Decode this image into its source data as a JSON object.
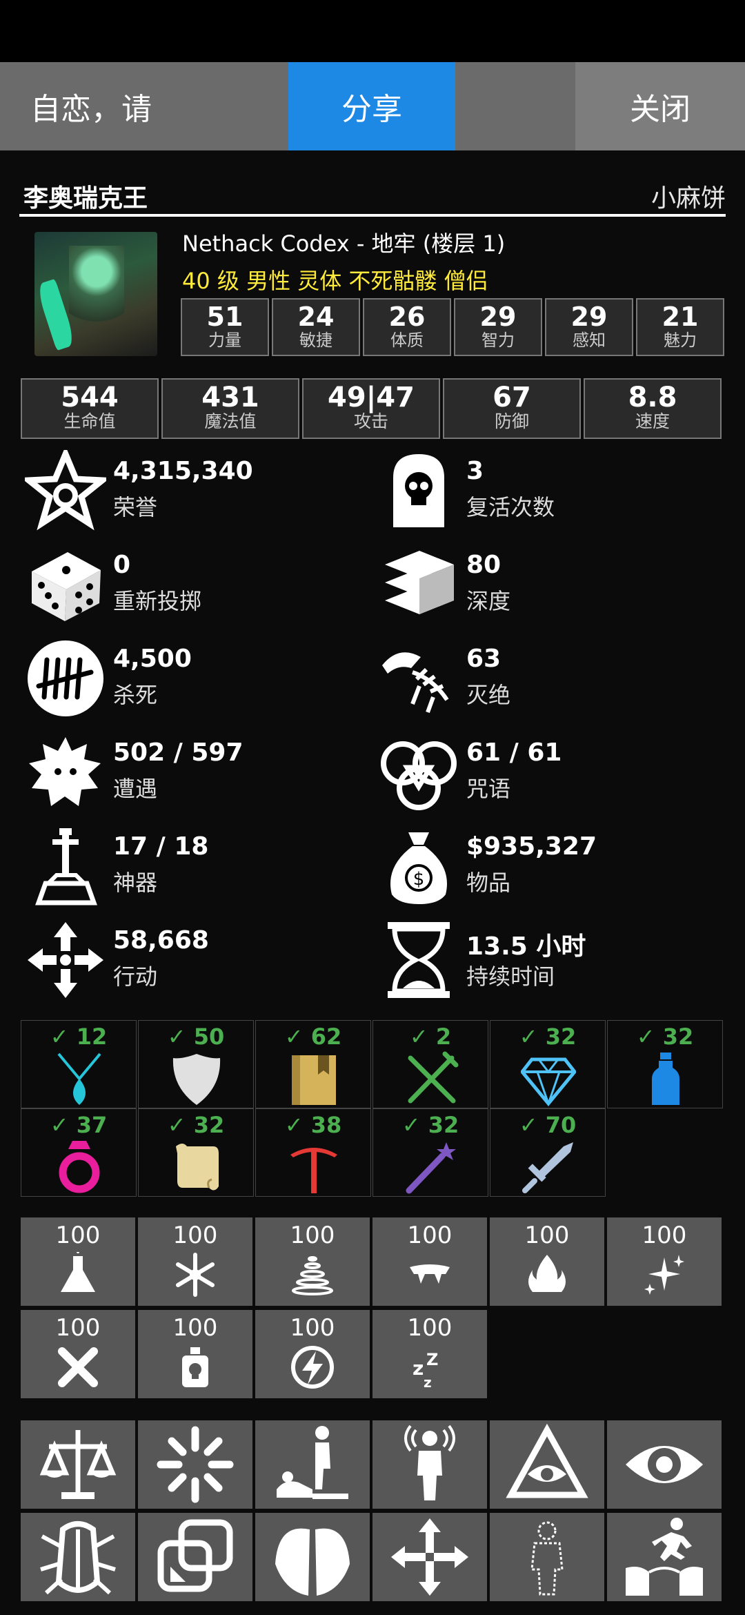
{
  "tabs": {
    "left": "自恋，请",
    "mid": "分享",
    "right": "关闭"
  },
  "header": {
    "name": "李奥瑞克王",
    "player": "小麻饼"
  },
  "game": {
    "title": "Nethack Codex - 地牢 (楼层 1)",
    "subtitle": "40 级 男性 灵体 不死骷髅 僧侣"
  },
  "attributes": [
    {
      "v": "51",
      "l": "力量"
    },
    {
      "v": "24",
      "l": "敏捷"
    },
    {
      "v": "26",
      "l": "体质"
    },
    {
      "v": "29",
      "l": "智力"
    },
    {
      "v": "29",
      "l": "感知"
    },
    {
      "v": "21",
      "l": "魅力"
    }
  ],
  "vitals": [
    {
      "v": "544",
      "l": "生命值"
    },
    {
      "v": "431",
      "l": "魔法值"
    },
    {
      "v": "49|47",
      "l": "攻击"
    },
    {
      "v": "67",
      "l": "防御"
    },
    {
      "v": "8.8",
      "l": "速度"
    }
  ],
  "records": [
    {
      "icon": "star-icon",
      "v": "4,315,340",
      "l": "荣誉"
    },
    {
      "icon": "tombstone-skull-icon",
      "v": "3",
      "l": "复活次数"
    },
    {
      "icon": "dice-icon",
      "v": "0",
      "l": "重新投掷"
    },
    {
      "icon": "stairs-icon",
      "v": "80",
      "l": "深度"
    },
    {
      "icon": "tally-icon",
      "v": "4,500",
      "l": "杀死"
    },
    {
      "icon": "dragon-skeleton-icon",
      "v": "63",
      "l": "灭绝"
    },
    {
      "icon": "monster-icon",
      "v": "502 / 597",
      "l": "遭遇"
    },
    {
      "icon": "triquetra-icon",
      "v": "61 / 61",
      "l": "咒语"
    },
    {
      "icon": "sword-in-stone-icon",
      "v": "17 / 18",
      "l": "神器"
    },
    {
      "icon": "money-bag-icon",
      "v": "$935,327",
      "l": "物品"
    },
    {
      "icon": "move-arrows-icon",
      "v": "58,668",
      "l": "行动"
    },
    {
      "icon": "hourglass-icon",
      "v": "13.5 小时",
      "l": "持续时间"
    }
  ],
  "item_counts": [
    {
      "icon": "amulet-icon",
      "c": "✓ 12",
      "color": "#26c6da"
    },
    {
      "icon": "shield-icon",
      "c": "✓ 50",
      "color": "#e0e0e0"
    },
    {
      "icon": "spellbook-icon",
      "c": "✓ 62",
      "color": "#d4b35a"
    },
    {
      "icon": "fork-knife-icon",
      "c": "✓ 2",
      "color": "#4caf50"
    },
    {
      "icon": "gem-icon",
      "c": "✓ 32",
      "color": "#4fc3f7"
    },
    {
      "icon": "potion-bottle-icon",
      "c": "✓ 32",
      "color": "#1e88e5"
    },
    {
      "icon": "ring-icon",
      "c": "✓ 37",
      "color": "#e91e9c"
    },
    {
      "icon": "scroll-icon",
      "c": "✓ 32",
      "color": "#e8d8a0"
    },
    {
      "icon": "pickaxe-icon",
      "c": "✓ 38",
      "color": "#e53935"
    },
    {
      "icon": "wand-icon",
      "c": "✓ 32",
      "color": "#7e57c2"
    },
    {
      "icon": "sword-icon",
      "c": "✓ 70",
      "color": "#b0c4de"
    }
  ],
  "resistances": [
    {
      "icon": "flask-icon",
      "n": "100"
    },
    {
      "icon": "snowflake-icon",
      "n": "100"
    },
    {
      "icon": "tornado-icon",
      "n": "100"
    },
    {
      "icon": "fangs-icon",
      "n": "100"
    },
    {
      "icon": "fire-icon",
      "n": "100"
    },
    {
      "icon": "sparkles-icon",
      "n": "100"
    },
    {
      "icon": "cross-bones-icon",
      "n": "100"
    },
    {
      "icon": "poison-bottle-icon",
      "n": "100"
    },
    {
      "icon": "lightning-icon",
      "n": "100"
    },
    {
      "icon": "sleep-icon",
      "n": "100"
    }
  ],
  "intrinsics": [
    {
      "icon": "scales-icon"
    },
    {
      "icon": "burst-icon"
    },
    {
      "icon": "stoned-figures-icon"
    },
    {
      "icon": "telepathy-figure-icon"
    },
    {
      "icon": "eye-pyramid-icon"
    },
    {
      "icon": "eye-icon"
    },
    {
      "icon": "beetle-icon"
    },
    {
      "icon": "overlap-squares-icon"
    },
    {
      "icon": "wings-icon"
    },
    {
      "icon": "teleport-arrows-icon"
    },
    {
      "icon": "invisible-figure-icon"
    },
    {
      "icon": "jumping-figure-icon"
    }
  ]
}
